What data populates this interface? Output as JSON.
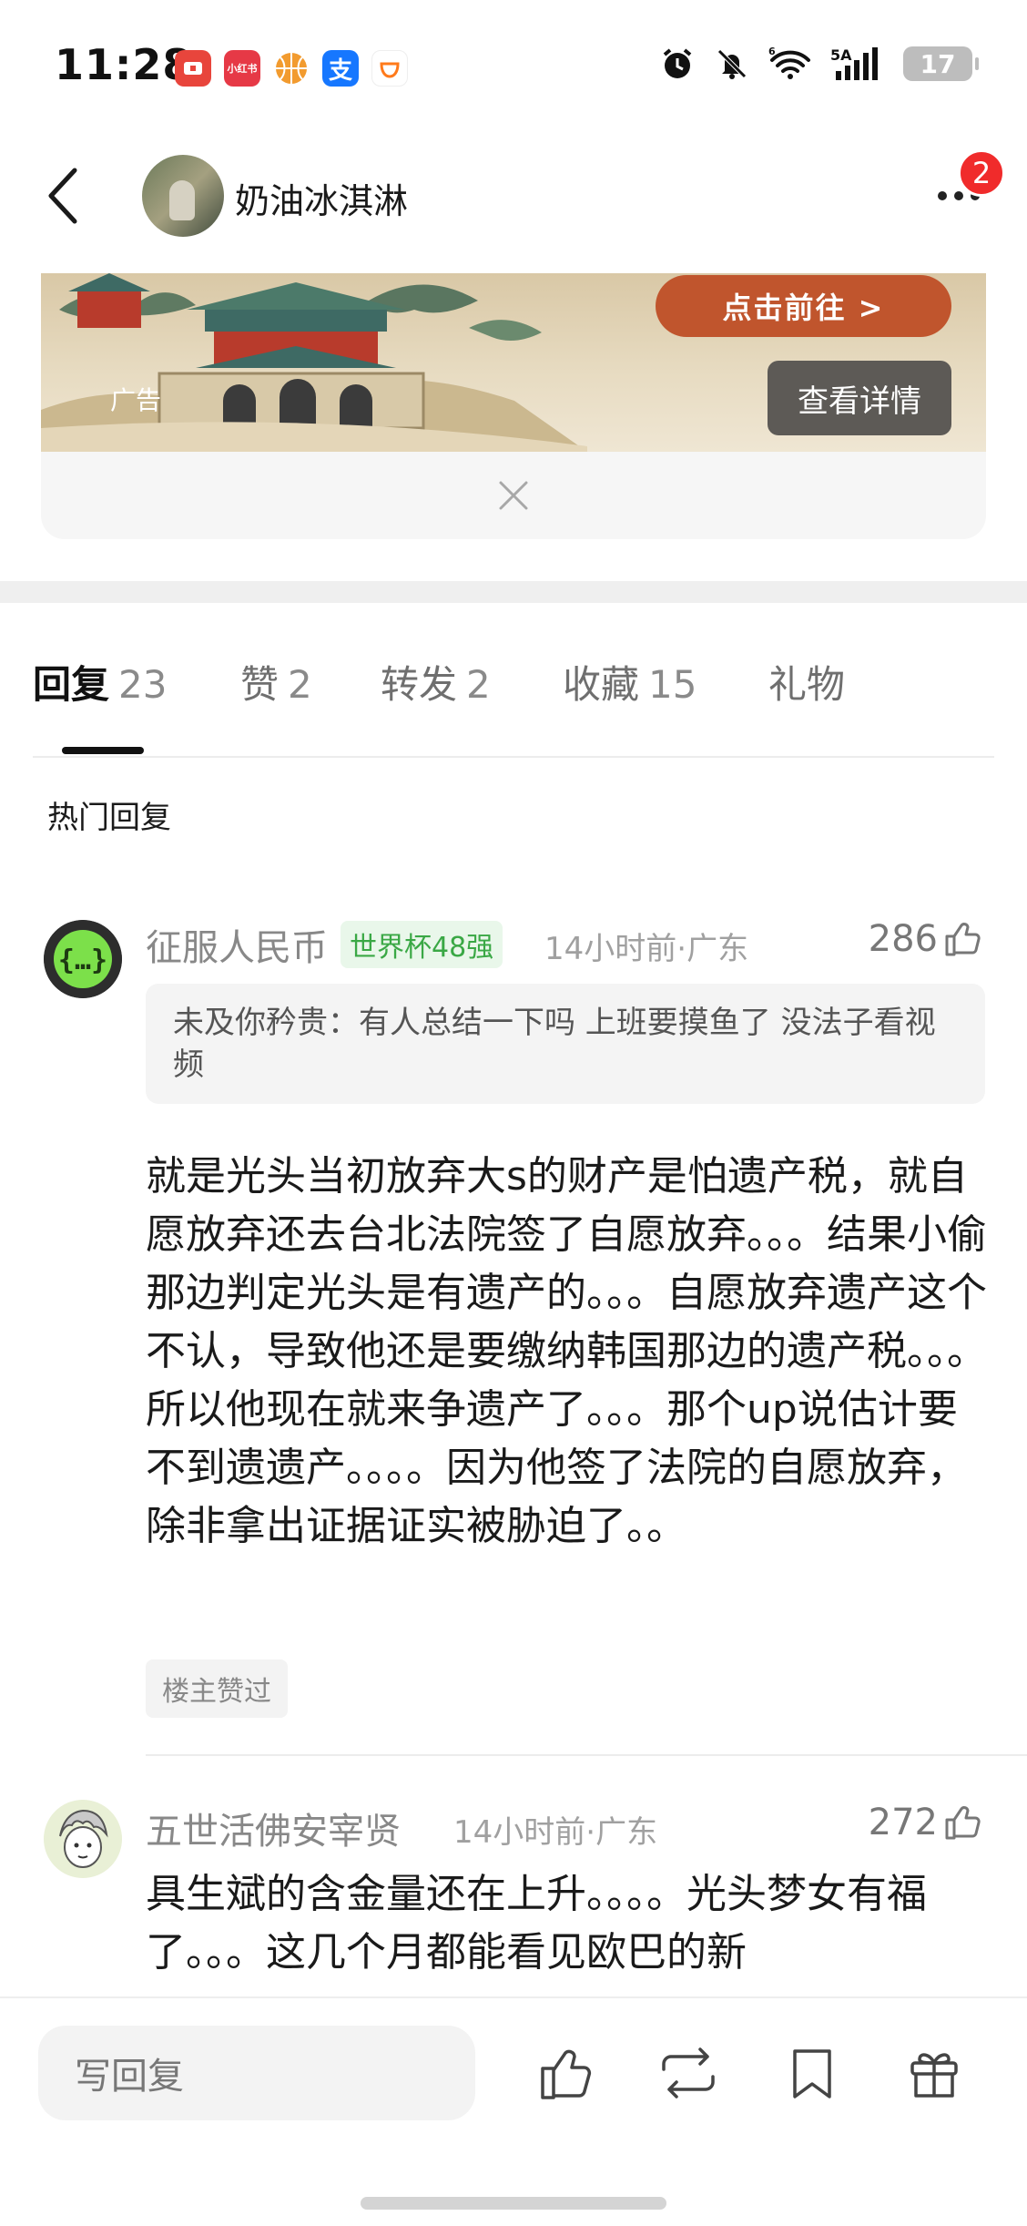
{
  "status_bar": {
    "time": "11:28",
    "network": "5A",
    "network_sup": "6",
    "battery": "17",
    "app_icons": [
      "video-app-icon",
      "xiaohongshu-icon",
      "basketball-icon",
      "alipay-icon",
      "didi-icon"
    ],
    "xhs_label": "小红书"
  },
  "header": {
    "title": "奶油冰淇淋",
    "notification_count": "2"
  },
  "ad": {
    "label": "广告",
    "cta": "点击前往 >",
    "detail": "查看详情"
  },
  "tabs": [
    {
      "name": "回复",
      "count": "23",
      "active": true
    },
    {
      "name": "赞",
      "count": "2",
      "active": false
    },
    {
      "name": "转发",
      "count": "2",
      "active": false
    },
    {
      "name": "收藏",
      "count": "15",
      "active": false
    },
    {
      "name": "礼物",
      "count": "",
      "active": false
    }
  ],
  "section": {
    "hot_title": "热门回复"
  },
  "comments": [
    {
      "name": "征服人民币",
      "badge": "世界杯48强",
      "meta": "14小时前·广东",
      "likes": "286",
      "quote": "未及你矜贵：有人总结一下吗 上班要摸鱼了 没法子看视频",
      "text": "就是光头当初放弃大s的财产是怕遗产税，就自愿放弃还去台北法院签了自愿放弃。。。结果小偷那边判定光头是有遗产的。。。自愿放弃遗产这个不认，导致他还是要缴纳韩国那边的遗产税。。。所以他现在就来争遗产了。。。那个up说估计要不到遗遗产。。。。因为他签了法院的自愿放弃，除非拿出证据证实被胁迫了。。",
      "tag": "楼主赞过"
    },
    {
      "name": "五世活佛安宰贤",
      "meta": "14小时前·广东",
      "likes": "272",
      "text": "具生斌的含金量还在上升。。。。光头梦女有福了。。。这几个月都能看见欧巴的新"
    }
  ],
  "bottom_bar": {
    "reply_placeholder": "写回复"
  },
  "colors": {
    "accent_red": "#f02b2b",
    "ad_cta": "#c0552d",
    "badge_green": "#3aa845"
  }
}
